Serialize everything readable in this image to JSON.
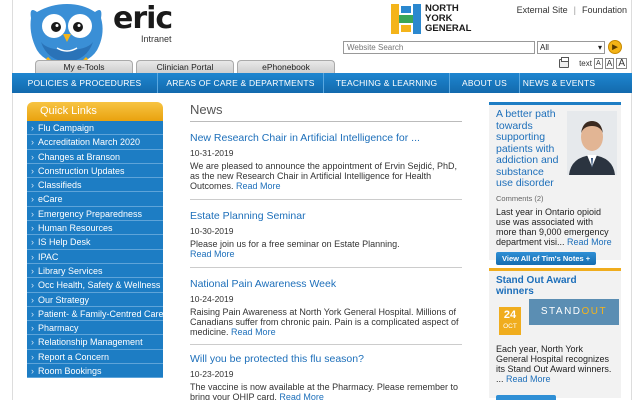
{
  "header": {
    "brand": "eric",
    "brand_sub": "Intranet",
    "org_line1": "NORTH",
    "org_line2": "YORK",
    "org_line3": "GENERAL",
    "top_links": [
      "External Site",
      "Foundation"
    ],
    "search_placeholder": "Website Search",
    "search_scope": "All",
    "tabs": [
      "My e-Tools",
      "Clinician Portal",
      "ePhonebook"
    ],
    "text_label": "text",
    "text_sizes": [
      "A",
      "A",
      "A"
    ]
  },
  "nav": [
    "POLICIES & PROCEDURES",
    "AREAS OF CARE & DEPARTMENTS",
    "TEACHING & LEARNING",
    "ABOUT US",
    "NEWS & EVENTS"
  ],
  "sidebar": {
    "title": "Quick Links",
    "items": [
      "Flu Campaign",
      "Accreditation March 2020",
      "Changes at Branson",
      "Construction Updates",
      "Classifieds",
      "eCare",
      "Emergency Preparedness",
      "Human Resources",
      "IS Help Desk",
      "IPAC",
      "Library Services",
      "Occ Health, Safety & Wellness",
      "Our Strategy",
      "Patient- & Family-Centred Care",
      "Pharmacy",
      "Relationship Management",
      "Report a Concern",
      "Room Bookings"
    ]
  },
  "news": {
    "title": "News",
    "more_label": "Read More",
    "items": [
      {
        "title": "New Research Chair in Artificial Intelligence for ...",
        "date": "10-31-2019",
        "body": "We are pleased to announce the appointment of Ervin Sejdić, PhD, as the new Research Chair in Artificial Intelligence for Health Outcomes."
      },
      {
        "title": "Estate Planning Seminar",
        "date": "10-30-2019",
        "body": "Please join us for a free seminar on Estate Planning."
      },
      {
        "title": "National Pain Awareness Week",
        "date": "10-24-2019",
        "body": "Raising Pain Awareness at North York General Hospital. Millions of Canadians suffer from chronic pain. Pain is a complicated aspect of medicine."
      },
      {
        "title": "Will you be protected this flu season?",
        "date": "10-23-2019",
        "body": "The vaccine is now available at the Pharmacy. Please remember to bring your OHIP card."
      }
    ]
  },
  "blog": {
    "title": "A better path towards supporting patients with addiction and substance use disorder",
    "comments": "Comments (2)",
    "body": "Last year in Ontario opioid use was associated with more than 9,000 emergency department visi...",
    "more": "Read More",
    "button": "View All of Tim's Notes +"
  },
  "award": {
    "title": "Stand Out Award winners",
    "day": "24",
    "month": "OCT",
    "logo_a": "STAND",
    "logo_b": "OUT",
    "body": "Each year, North York General Hospital recognizes its Stand Out Award winners. ...",
    "more": "Read More"
  },
  "colors": {
    "nav_blue": "#1d7dc4",
    "accent_orange": "#f0ad1e",
    "link_blue": "#1d6fba"
  }
}
